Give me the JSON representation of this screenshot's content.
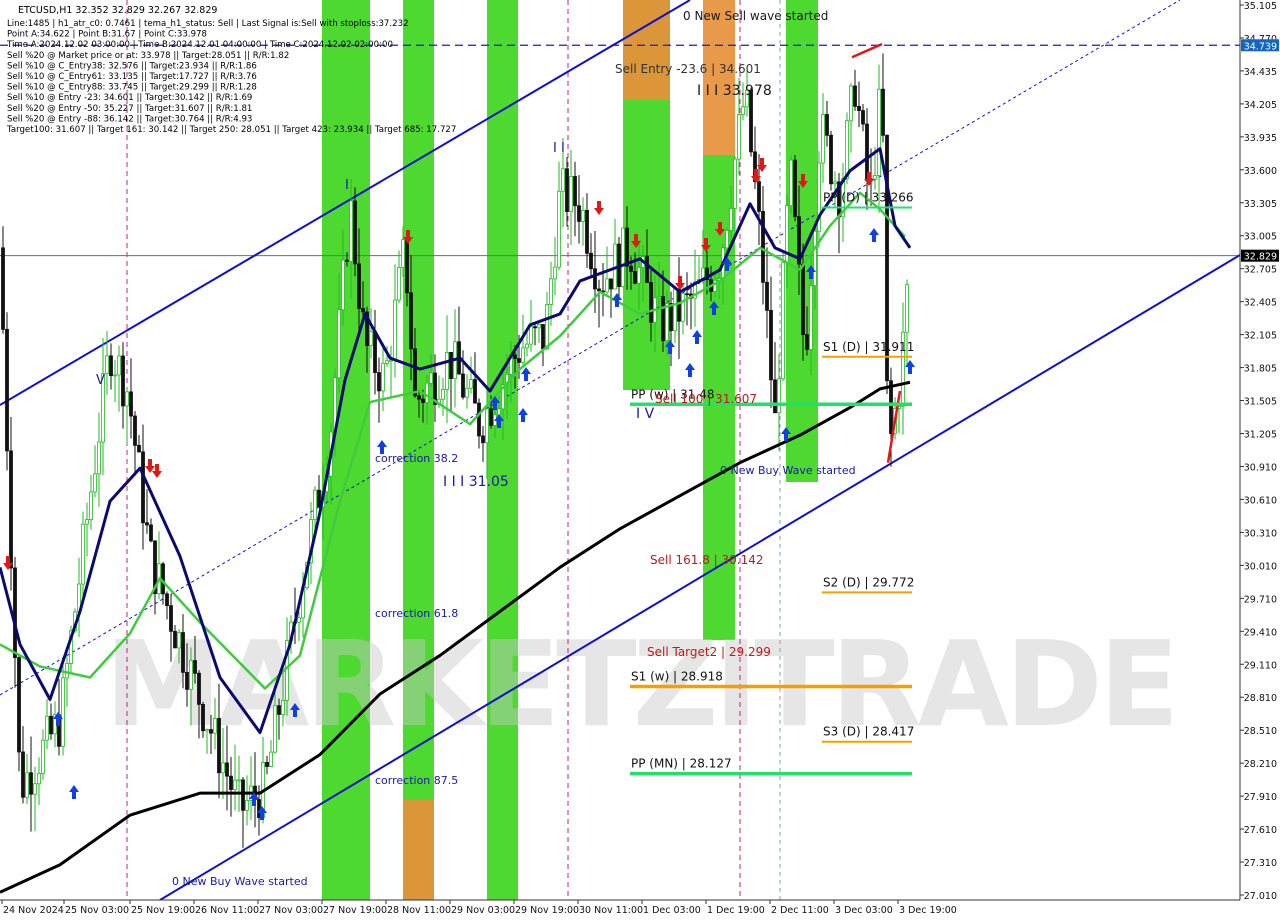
{
  "chart_data": {
    "type": "candlestick",
    "symbol_line": "ETCUSD,H1  32.352 32.829 32.267 32.829",
    "info_lines": [
      "Line:1485 | h1_atr_c0: 0.7461 | tema_h1_status: Sell | Last Signal is:Sell with stoploss:37.232",
      "Point A:34.622 | Point B:31.67 | Point C:33.978",
      "Time A:2024.12.02 03:00:00 | Time B:2024.12.01 04:00:00 | Time C:2024.12.02 02:00:00",
      "Sell %20 @ Market price or at: 33.978 || Target:28.051 || R/R:1.82",
      "Sell %10 @ C_Entry38: 32.576 || Target:23.934 || R/R:1.86",
      "Sell %10 @ C_Entry61: 33.135 || Target:17.727 || R/R:3.76",
      "Sell %10 @ C_Entry88: 33.745 || Target:29.299 || R/R:1.28",
      "Sell %10 @ Entry -23: 34.601 || Target:30.142 || R/R:1.69",
      "Sell %20 @ Entry -50: 35.227 || Target:31.607 || R/R:1.81",
      "Sell %20 @ Entry -88: 36.142 || Target:30.764 || R/R:4.93",
      "Target100: 31.607 || Target 161: 30.142 || Target 250: 28.051 || Target 423: 23.934 || Target 685: 17.727"
    ],
    "y_ticks": [
      "35.105",
      "34.770",
      "34.435",
      "34.205",
      "33.935",
      "33.600",
      "33.305",
      "33.005",
      "32.705",
      "32.405",
      "32.105",
      "31.805",
      "31.505",
      "31.205",
      "30.910",
      "30.610",
      "30.310",
      "30.010",
      "29.710",
      "29.410",
      "29.110",
      "28.810",
      "28.510",
      "28.210",
      "27.910",
      "27.610",
      "27.310",
      "27.010"
    ],
    "ylim": [
      26.98,
      35.15
    ],
    "x_labels": [
      "24 Nov 2024",
      "25 Nov 03:00",
      "25 Nov 19:00",
      "26 Nov 11:00",
      "27 Nov 03:00",
      "27 Nov 19:00",
      "28 Nov 11:00",
      "29 Nov 03:00",
      "29 Nov 19:00",
      "30 Nov 11:00",
      "1 Dec 03:00",
      "1 Dec 19:00",
      "2 Dec 11:00",
      "3 Dec 03:00",
      "3 Dec 19:00"
    ],
    "price_tags": [
      {
        "label": "34.739",
        "value": 34.739,
        "color": "#1565c0"
      },
      {
        "label": "32.829",
        "value": 32.829,
        "color": "#000000"
      }
    ],
    "levels": [
      {
        "label": "PP (D) | 33.266",
        "value": 33.266,
        "color": "#22e06a"
      },
      {
        "label": "S1 (D) | 31.911",
        "value": 31.911,
        "color": "#f5a000"
      },
      {
        "label": "PP (w) | 31.48",
        "value": 31.48,
        "color": "#22e06a"
      },
      {
        "label": "S2 (D) | 29.772",
        "value": 29.772,
        "color": "#f5a000"
      },
      {
        "label": "S1 (w) | 28.918",
        "value": 28.918,
        "color": "#f5a000"
      },
      {
        "label": "S3 (D) | 28.417",
        "value": 28.417,
        "color": "#f5a000"
      },
      {
        "label": "PP (MN) | 28.127",
        "value": 28.127,
        "color": "#22e06a"
      }
    ],
    "annotations": [
      {
        "text": "Sell Entry -23.6 | 34.601",
        "color": "#333333"
      },
      {
        "text": "I I I 33.978",
        "color": "#1a1a1a"
      },
      {
        "text": "Sell 100 | 31.607",
        "color": "#b71c1c"
      },
      {
        "text": "Sell 161.8 | 30.142",
        "color": "#b71c1c"
      },
      {
        "text": "Sell Target2 | 29.299",
        "color": "#b71c1c"
      },
      {
        "text": "0 New Sell wave started",
        "color": "#1a1a1a"
      },
      {
        "text": "0 New Buy Wave started",
        "color": "#1a1aa0"
      },
      {
        "text": "correction 38.2",
        "color": "#1a1aa0"
      },
      {
        "text": "correction 61.8",
        "color": "#1a1aa0"
      },
      {
        "text": "correction 87.5",
        "color": "#1a1aa0"
      },
      {
        "text": "I I I 31.05",
        "color": "#1a1aa0"
      },
      {
        "text": "I V",
        "color": "#1a1aa0"
      },
      {
        "text": "I I",
        "color": "#1a1aa0"
      },
      {
        "text": "V",
        "color": "#1a1aa0"
      },
      {
        "text": "I",
        "color": "#1a1aa0"
      }
    ],
    "watermark": "MARKETZITRADE",
    "colors": {
      "up": "#22bb22",
      "down": "#111111",
      "channel": "#1111cc",
      "ma_black": "#000000",
      "ma_navy": "#0a0a70",
      "ma_green": "#3ecb3e",
      "zone_green": "#3fd61f",
      "zone_orange": "#e6903a"
    }
  }
}
